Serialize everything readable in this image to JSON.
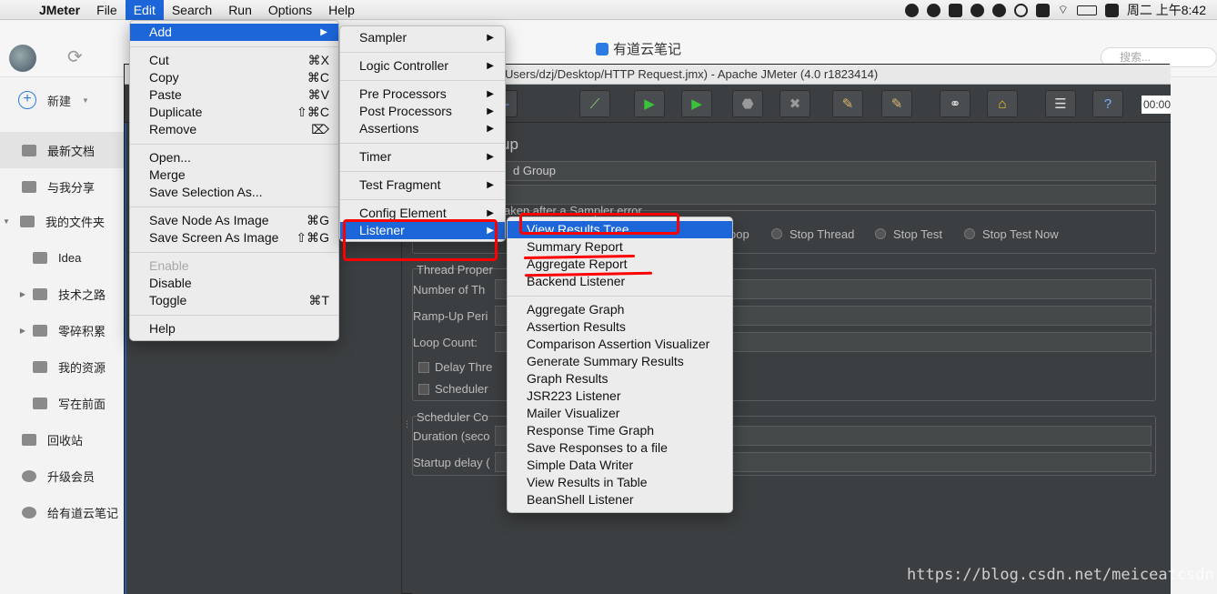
{
  "menubar": {
    "app": "JMeter",
    "items": [
      "File",
      "Edit",
      "Search",
      "Run",
      "Options",
      "Help"
    ],
    "active": "Edit",
    "clock": "周二 上午8:42"
  },
  "youdao": {
    "title": "有道云笔记",
    "search_placeholder": "搜索...",
    "new_label": "新建",
    "sidebar": [
      {
        "label": "最新文档",
        "selected": true,
        "icon": "layers-icon"
      },
      {
        "label": "与我分享",
        "icon": "share-user-icon"
      },
      {
        "label": "我的文件夹",
        "icon": "folder-icon",
        "expanded": true
      },
      {
        "label": "Idea",
        "icon": "folder-icon"
      },
      {
        "label": "技术之路",
        "icon": "folder-icon"
      },
      {
        "label": "零碎积累",
        "icon": "folder-icon"
      },
      {
        "label": "我的资源",
        "icon": "folder-icon"
      },
      {
        "label": "写在前面",
        "icon": "folder-icon"
      },
      {
        "label": "回收站",
        "icon": "trash-icon"
      },
      {
        "label": "升级会员",
        "icon": "vip-icon"
      },
      {
        "label": "给有道云笔记",
        "icon": "star-icon"
      }
    ]
  },
  "jmeter": {
    "window_title": "Users/dzj/Desktop/HTTP Request.jmx) - Apache JMeter (4.0 r1823414)",
    "timer": "00:00",
    "panel": {
      "heading": "up",
      "name_value": "d Group",
      "error_label": "aken after a Sampler error",
      "radio_loop": "oop",
      "radio_stop_thread": "Stop Thread",
      "radio_stop_test": "Stop Test",
      "radio_stop_test_now": "Stop Test Now",
      "thread_props": "Thread Proper",
      "num_threads": "Number of Th",
      "ramp_up": "Ramp-Up Peri",
      "loop_count": "Loop Count:",
      "delay": "Delay Thre",
      "scheduler": "Scheduler",
      "scheduler_conf": "Scheduler Co",
      "duration": "Duration (seco",
      "startup_delay": "Startup delay ("
    }
  },
  "edit_menu": [
    {
      "label": "Add",
      "submenu": true,
      "highlight": true
    },
    {
      "sep": true
    },
    {
      "label": "Cut",
      "shortcut": "⌘X"
    },
    {
      "label": "Copy",
      "shortcut": "⌘C"
    },
    {
      "label": "Paste",
      "shortcut": "⌘V"
    },
    {
      "label": "Duplicate",
      "shortcut": "⇧⌘C"
    },
    {
      "label": "Remove",
      "shortcut": "⌦"
    },
    {
      "sep": true
    },
    {
      "label": "Open..."
    },
    {
      "label": "Merge"
    },
    {
      "label": "Save Selection As..."
    },
    {
      "sep": true
    },
    {
      "label": "Save Node As Image",
      "shortcut": "⌘G"
    },
    {
      "label": "Save Screen As Image",
      "shortcut": "⇧⌘G"
    },
    {
      "sep": true
    },
    {
      "label": "Enable",
      "disabled": true
    },
    {
      "label": "Disable"
    },
    {
      "label": "Toggle",
      "shortcut": "⌘T"
    },
    {
      "sep": true
    },
    {
      "label": "Help"
    }
  ],
  "add_menu": [
    {
      "label": "Sampler",
      "submenu": true
    },
    {
      "sep": true
    },
    {
      "label": "Logic Controller",
      "submenu": true
    },
    {
      "sep": true
    },
    {
      "label": "Pre Processors",
      "submenu": true
    },
    {
      "label": "Post Processors",
      "submenu": true
    },
    {
      "label": "Assertions",
      "submenu": true
    },
    {
      "sep": true
    },
    {
      "label": "Timer",
      "submenu": true
    },
    {
      "sep": true
    },
    {
      "label": "Test Fragment",
      "submenu": true
    },
    {
      "sep": true
    },
    {
      "label": "Config Element",
      "submenu": true
    },
    {
      "label": "Listener",
      "submenu": true,
      "highlight": true
    }
  ],
  "listener_menu": [
    {
      "label": "View Results Tree",
      "highlight": true
    },
    {
      "label": "Summary Report"
    },
    {
      "label": "Aggregate Report"
    },
    {
      "label": "Backend Listener"
    },
    {
      "sep": true
    },
    {
      "label": "Aggregate Graph"
    },
    {
      "label": "Assertion Results"
    },
    {
      "label": "Comparison Assertion Visualizer"
    },
    {
      "label": "Generate Summary Results"
    },
    {
      "label": "Graph Results"
    },
    {
      "label": "JSR223 Listener"
    },
    {
      "label": "Mailer Visualizer"
    },
    {
      "label": "Response Time Graph"
    },
    {
      "label": "Save Responses to a file"
    },
    {
      "label": "Simple Data Writer"
    },
    {
      "label": "View Results in Table"
    },
    {
      "label": "BeanShell Listener"
    }
  ],
  "watermark": "https://blog.csdn.net/meiceatcsdn",
  "colors": {
    "highlight": "#1d66d9",
    "annotation": "#ff0000"
  }
}
